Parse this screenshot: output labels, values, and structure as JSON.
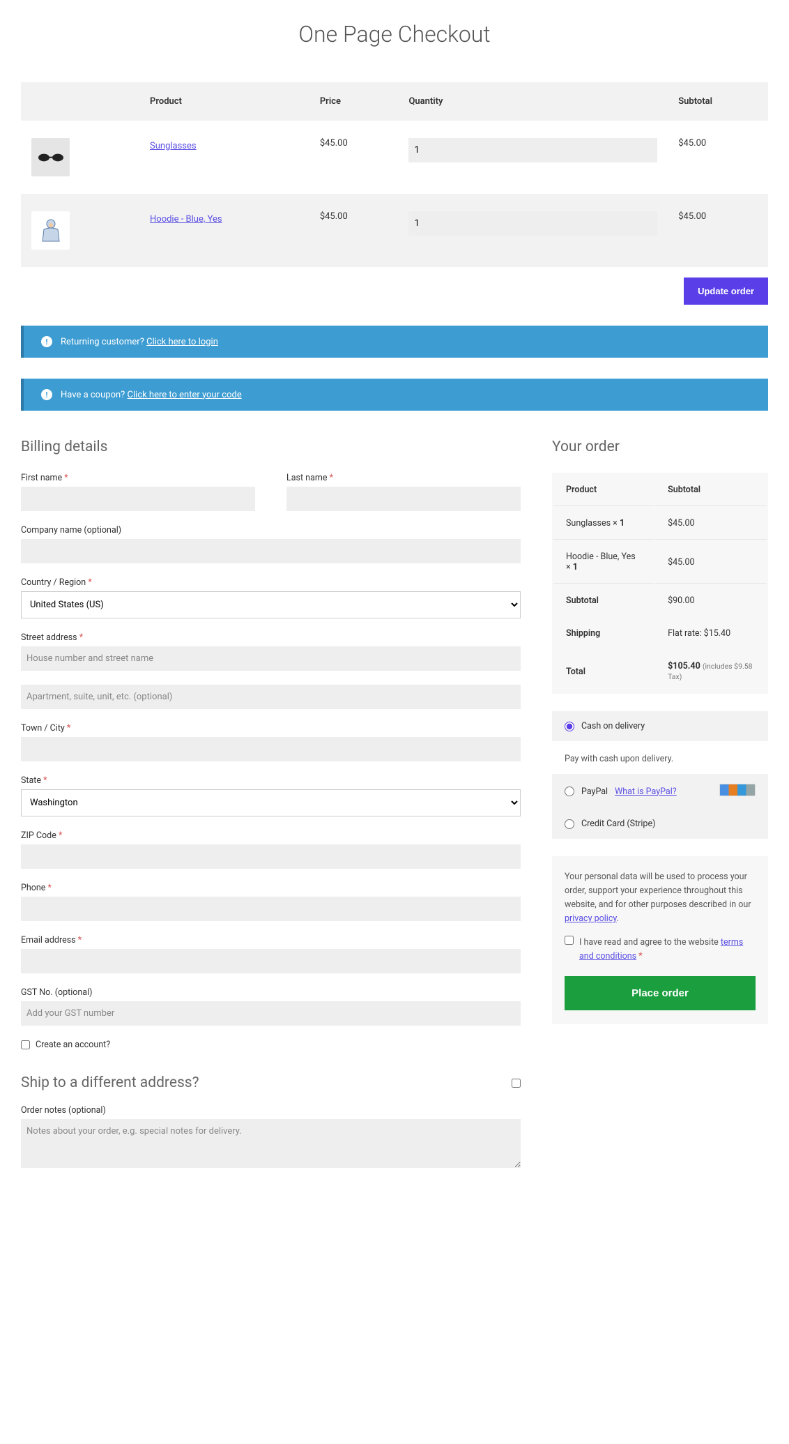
{
  "page_title": "One Page Checkout",
  "products_table": {
    "headers": {
      "product": "Product",
      "price": "Price",
      "quantity": "Quantity",
      "subtotal": "Subtotal"
    },
    "rows": [
      {
        "name": "Sunglasses",
        "price": "$45.00",
        "qty": "1",
        "subtotal": "$45.00"
      },
      {
        "name": "Hoodie - Blue, Yes",
        "price": "$45.00",
        "qty": "1",
        "subtotal": "$45.00"
      }
    ]
  },
  "update_button": "Update order",
  "returning_customer": {
    "text": "Returning customer? ",
    "link": "Click here to login"
  },
  "coupon": {
    "text": "Have a coupon? ",
    "link": "Click here to enter your code"
  },
  "billing": {
    "heading": "Billing details",
    "first_name": "First name",
    "last_name": "Last name",
    "company": "Company name (optional)",
    "country": "Country / Region",
    "country_value": "United States (US)",
    "street": "Street address",
    "street_ph": "House number and street name",
    "apt_ph": "Apartment, suite, unit, etc. (optional)",
    "city": "Town / City",
    "state": "State",
    "state_value": "Washington",
    "zip": "ZIP Code",
    "phone": "Phone",
    "email": "Email address",
    "gst": "GST No. (optional)",
    "gst_ph": "Add your GST number",
    "create_account": "Create an account?"
  },
  "shipping": {
    "heading": "Ship to a different address?"
  },
  "order_notes": {
    "label": "Order notes (optional)",
    "ph": "Notes about your order, e.g. special notes for delivery."
  },
  "your_order": {
    "heading": "Your order",
    "headers": {
      "product": "Product",
      "subtotal": "Subtotal"
    },
    "items": [
      {
        "name": "Sunglasses  ×",
        "qty": "1",
        "subtotal": "$45.00"
      },
      {
        "name": "Hoodie - Blue, Yes  ×",
        "qty": "1",
        "subtotal": "$45.00"
      }
    ],
    "subtotal_label": "Subtotal",
    "subtotal_value": "$90.00",
    "shipping_label": "Shipping",
    "shipping_value": "Flat rate: $15.40",
    "total_label": "Total",
    "total_value": "$105.40",
    "total_note": "(includes $9.58 Tax)"
  },
  "payment": {
    "cod_label": "Cash on delivery",
    "cod_desc": "Pay with cash upon delivery.",
    "paypal_label": "PayPal",
    "paypal_link": "What is PayPal?",
    "stripe_label": "Credit Card (Stripe)"
  },
  "privacy": {
    "text_a": "Your personal data will be used to process your order, support your experience throughout this website, and for other purposes described in our ",
    "link": "privacy policy",
    "text_b": ".",
    "terms_a": "I have read and agree to the website ",
    "terms_link": "terms and conditions",
    "req": "*"
  },
  "place_order": "Place order"
}
